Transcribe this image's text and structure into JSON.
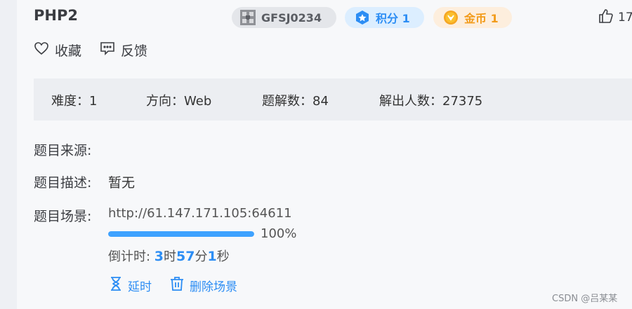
{
  "challenge": {
    "title": "PHP2"
  },
  "tags": {
    "user": "GFSJ0234",
    "points": "积分 1",
    "coins": "金币 1"
  },
  "likes": {
    "count": "17"
  },
  "actions": {
    "favorite": "收藏",
    "feedback": "反馈"
  },
  "stats": {
    "difficulty": "难度：1",
    "direction": "方向：Web",
    "writeups": "题解数：84",
    "solvers": "解出人数：27375"
  },
  "fields": {
    "source_label": "题目来源:",
    "desc_label": "题目描述:",
    "desc_value": "暂无",
    "scene_label": "题目场景:",
    "scene_url": "http://61.147.171.105:64611"
  },
  "progress": {
    "value": 1.0,
    "percent_label": "100%"
  },
  "countdown": {
    "prefix": "倒计时: ",
    "hours": "3",
    "hours_unit": "时",
    "minutes": "57",
    "minutes_unit": "分",
    "seconds": "1",
    "seconds_unit": "秒"
  },
  "buttons": {
    "extend": "延时",
    "delete_scene": "删除场景"
  },
  "watermark": "CSDN @吕某某",
  "colors": {
    "accent": "#2c8df4",
    "coin": "#f29b1a",
    "progress": "#3ea2ff"
  }
}
